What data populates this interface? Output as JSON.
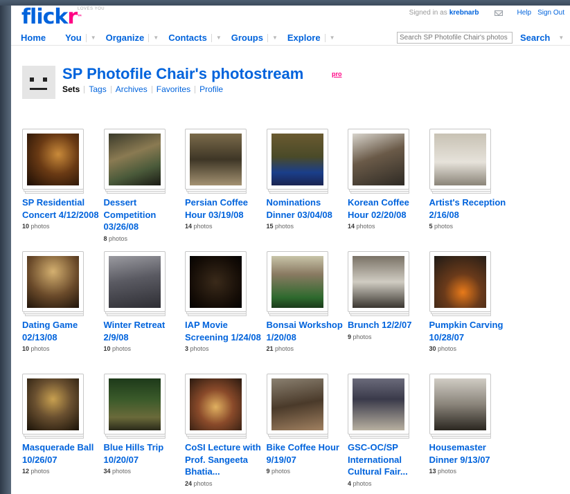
{
  "header": {
    "logo_text_blue": "flick",
    "logo_text_pink": "r",
    "logo_tm": "™",
    "logo_tagline": "LOVES YOU",
    "signed_in_label": "Signed in as",
    "username": "krebnarb",
    "help_label": "Help",
    "signout_label": "Sign Out"
  },
  "nav": {
    "home": "Home",
    "you": "You",
    "organize": "Organize",
    "contacts": "Contacts",
    "groups": "Groups",
    "explore": "Explore",
    "caret": "▼",
    "search_placeholder": "Search SP Photofile Chair's photos",
    "search_button": "Search"
  },
  "profile": {
    "title": "SP Photofile Chair's photostream",
    "badge": "pro",
    "subnav": [
      "Sets",
      "Tags",
      "Archives",
      "Favorites",
      "Profile"
    ],
    "active": "Sets"
  },
  "sets": [
    {
      "title": "SP Residential Concert 4/12/2008",
      "count": "10",
      "unit": "photos"
    },
    {
      "title": "Dessert Competition 03/26/08",
      "count": "8",
      "unit": "photos"
    },
    {
      "title": "Persian Coffee Hour 03/19/08",
      "count": "14",
      "unit": "photos"
    },
    {
      "title": "Nominations Dinner 03/04/08",
      "count": "15",
      "unit": "photos"
    },
    {
      "title": "Korean Coffee Hour 02/20/08",
      "count": "14",
      "unit": "photos"
    },
    {
      "title": "Artist's Reception 2/16/08",
      "count": "5",
      "unit": "photos"
    },
    {
      "title": "Dating Game 02/13/08",
      "count": "10",
      "unit": "photos"
    },
    {
      "title": "Winter Retreat 2/9/08",
      "count": "10",
      "unit": "photos"
    },
    {
      "title": "IAP Movie Screening 1/24/08",
      "count": "3",
      "unit": "photos"
    },
    {
      "title": "Bonsai Workshop 1/20/08",
      "count": "21",
      "unit": "photos"
    },
    {
      "title": "Brunch 12/2/07",
      "count": "9",
      "unit": "photos"
    },
    {
      "title": "Pumpkin Carving 10/28/07",
      "count": "30",
      "unit": "photos"
    },
    {
      "title": "Masquerade Ball 10/26/07",
      "count": "12",
      "unit": "photos"
    },
    {
      "title": "Blue Hills Trip 10/20/07",
      "count": "34",
      "unit": "photos"
    },
    {
      "title": "CoSI Lecture with Prof. Sangeeta Bhatia...",
      "count": "24",
      "unit": "photos"
    },
    {
      "title": "Bike Coffee Hour 9/19/07",
      "count": "9",
      "unit": "photos"
    },
    {
      "title": "GSC-OC/SP International Cultural Fair...",
      "count": "4",
      "unit": "photos"
    },
    {
      "title": "Housemaster Dinner 9/13/07",
      "count": "13",
      "unit": "photos"
    }
  ]
}
